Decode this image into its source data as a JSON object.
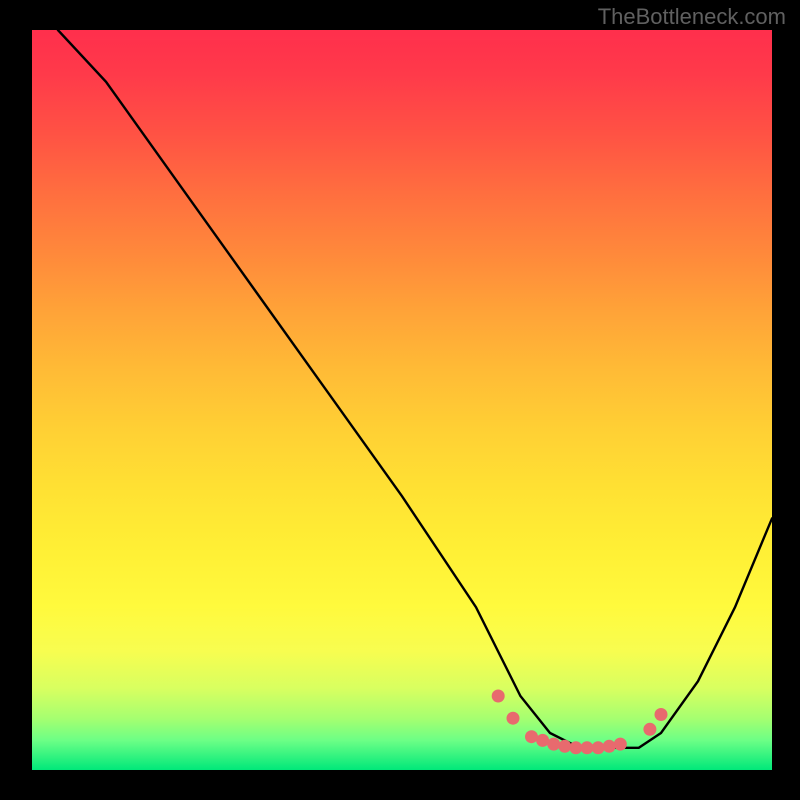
{
  "watermark": "TheBottleneck.com",
  "chart_data": {
    "type": "line",
    "title": "",
    "xlabel": "",
    "ylabel": "",
    "xlim": [
      0,
      100
    ],
    "ylim": [
      0,
      100
    ],
    "series": [
      {
        "name": "curve",
        "color": "#000000",
        "x": [
          3.5,
          10,
          20,
          30,
          40,
          50,
          60,
          63,
          66,
          70,
          74,
          78,
          82,
          85,
          90,
          95,
          100
        ],
        "values": [
          100,
          93,
          79,
          65,
          51,
          37,
          22,
          16,
          10,
          5,
          3,
          3,
          3,
          5,
          12,
          22,
          34
        ]
      }
    ],
    "markers": {
      "name": "bottom-highlight",
      "color": "#e86a6e",
      "radius_px": 6.5,
      "points": [
        {
          "x": 63.0,
          "y": 10.0
        },
        {
          "x": 65.0,
          "y": 7.0
        },
        {
          "x": 67.5,
          "y": 4.5
        },
        {
          "x": 69.0,
          "y": 4.0
        },
        {
          "x": 70.5,
          "y": 3.5
        },
        {
          "x": 72.0,
          "y": 3.2
        },
        {
          "x": 73.5,
          "y": 3.0
        },
        {
          "x": 75.0,
          "y": 3.0
        },
        {
          "x": 76.5,
          "y": 3.0
        },
        {
          "x": 78.0,
          "y": 3.2
        },
        {
          "x": 79.5,
          "y": 3.5
        },
        {
          "x": 83.5,
          "y": 5.5
        },
        {
          "x": 85.0,
          "y": 7.5
        }
      ]
    },
    "background_gradient": {
      "top": "#ff2f4c",
      "mid": "#ffe133",
      "bottom": "#00e87a"
    }
  }
}
